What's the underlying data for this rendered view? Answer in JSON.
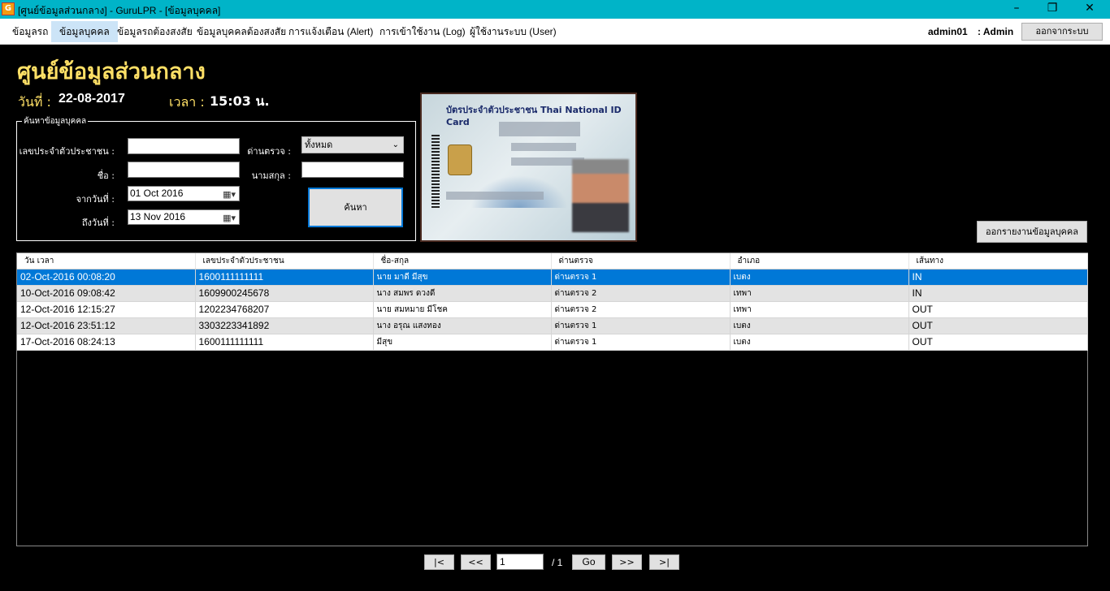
{
  "window": {
    "title": "[ศูนย์ข้อมูลส่วนกลาง] - GuruLPR - [ข้อมูลบุคคล]",
    "icon_letter": "G",
    "minimize": "–",
    "restore": "❐",
    "close": "✕"
  },
  "menu": {
    "items": [
      "ข้อมูลรถ",
      "ข้อมูลบุคคล",
      "ข้อมูลรถต้องสงสัย",
      "ข้อมูลบุคคลต้องสงสัย",
      "การแจ้งเตือน (Alert)",
      "การเข้าใช้งาน (Log)",
      "ผู้ใช้งานระบบ (User)"
    ],
    "active_index": 1,
    "username": "admin01",
    "role": ": Admin",
    "logout_label": "ออกจากระบบ"
  },
  "header": {
    "title": "ศูนย์ข้อมูลส่วนกลาง",
    "date_label": "วันที่ :",
    "date_value": "22-08-2017",
    "time_label": "เวลา :",
    "time_value": "15:03 น."
  },
  "search": {
    "legend": "ค้นหาข้อมูลบุคคล",
    "id_label": "เลขประจำตัวประชาชน :",
    "id_value": "",
    "checkpoint_label": "ด่านตรวจ :",
    "checkpoint_value": "ทั้งหมด",
    "name_label": "ชื่อ :",
    "name_value": "",
    "surname_label": "นามสกุล :",
    "surname_value": "",
    "from_label": "จากวันที่ :",
    "from_value": "01 Oct  2016",
    "to_label": "ถึงวันที่ :",
    "to_value": "13 Nov 2016",
    "search_label": "ค้นหา"
  },
  "idcard": {
    "header": "บัตรประจำตัวประชาชน  Thai National ID Card"
  },
  "export_label": "ออกรายงานข้อมูลบุคคล",
  "grid": {
    "columns": [
      "วัน เวลา",
      "เลขประจำตัวประชาชน",
      "ชื่อ-สกุล",
      "ด่านตรวจ",
      "อำเภอ",
      "เส้นทาง"
    ],
    "rows": [
      [
        "02-Oct-2016 00:08:20",
        "1600111111111",
        "นาย มาดี มีสุข",
        "ด่านตรวจ 1",
        "เบตง",
        "IN"
      ],
      [
        "10-Oct-2016 09:08:42",
        "1609900245678",
        "นาง สมพร ดวงดี",
        "ด่านตรวจ 2",
        "เทพา",
        "IN"
      ],
      [
        "12-Oct-2016 12:15:27",
        "1202234768207",
        "นาย สมหมาย มีโชค",
        "ด่านตรวจ 2",
        "เทพา",
        "OUT"
      ],
      [
        "12-Oct-2016 23:51:12",
        "3303223341892",
        "นาง อรุณ แสงทอง",
        "ด่านตรวจ 1",
        "เบตง",
        "OUT"
      ],
      [
        "17-Oct-2016 08:24:13",
        "1600111111111",
        "มีสุข",
        "ด่านตรวจ 1",
        "เบตง",
        "OUT"
      ]
    ],
    "selected_index": 0
  },
  "pager": {
    "first": "|<",
    "prev": "<<",
    "page": "1",
    "total": "/ 1",
    "go": "Go",
    "next": ">>",
    "last": ">|"
  }
}
